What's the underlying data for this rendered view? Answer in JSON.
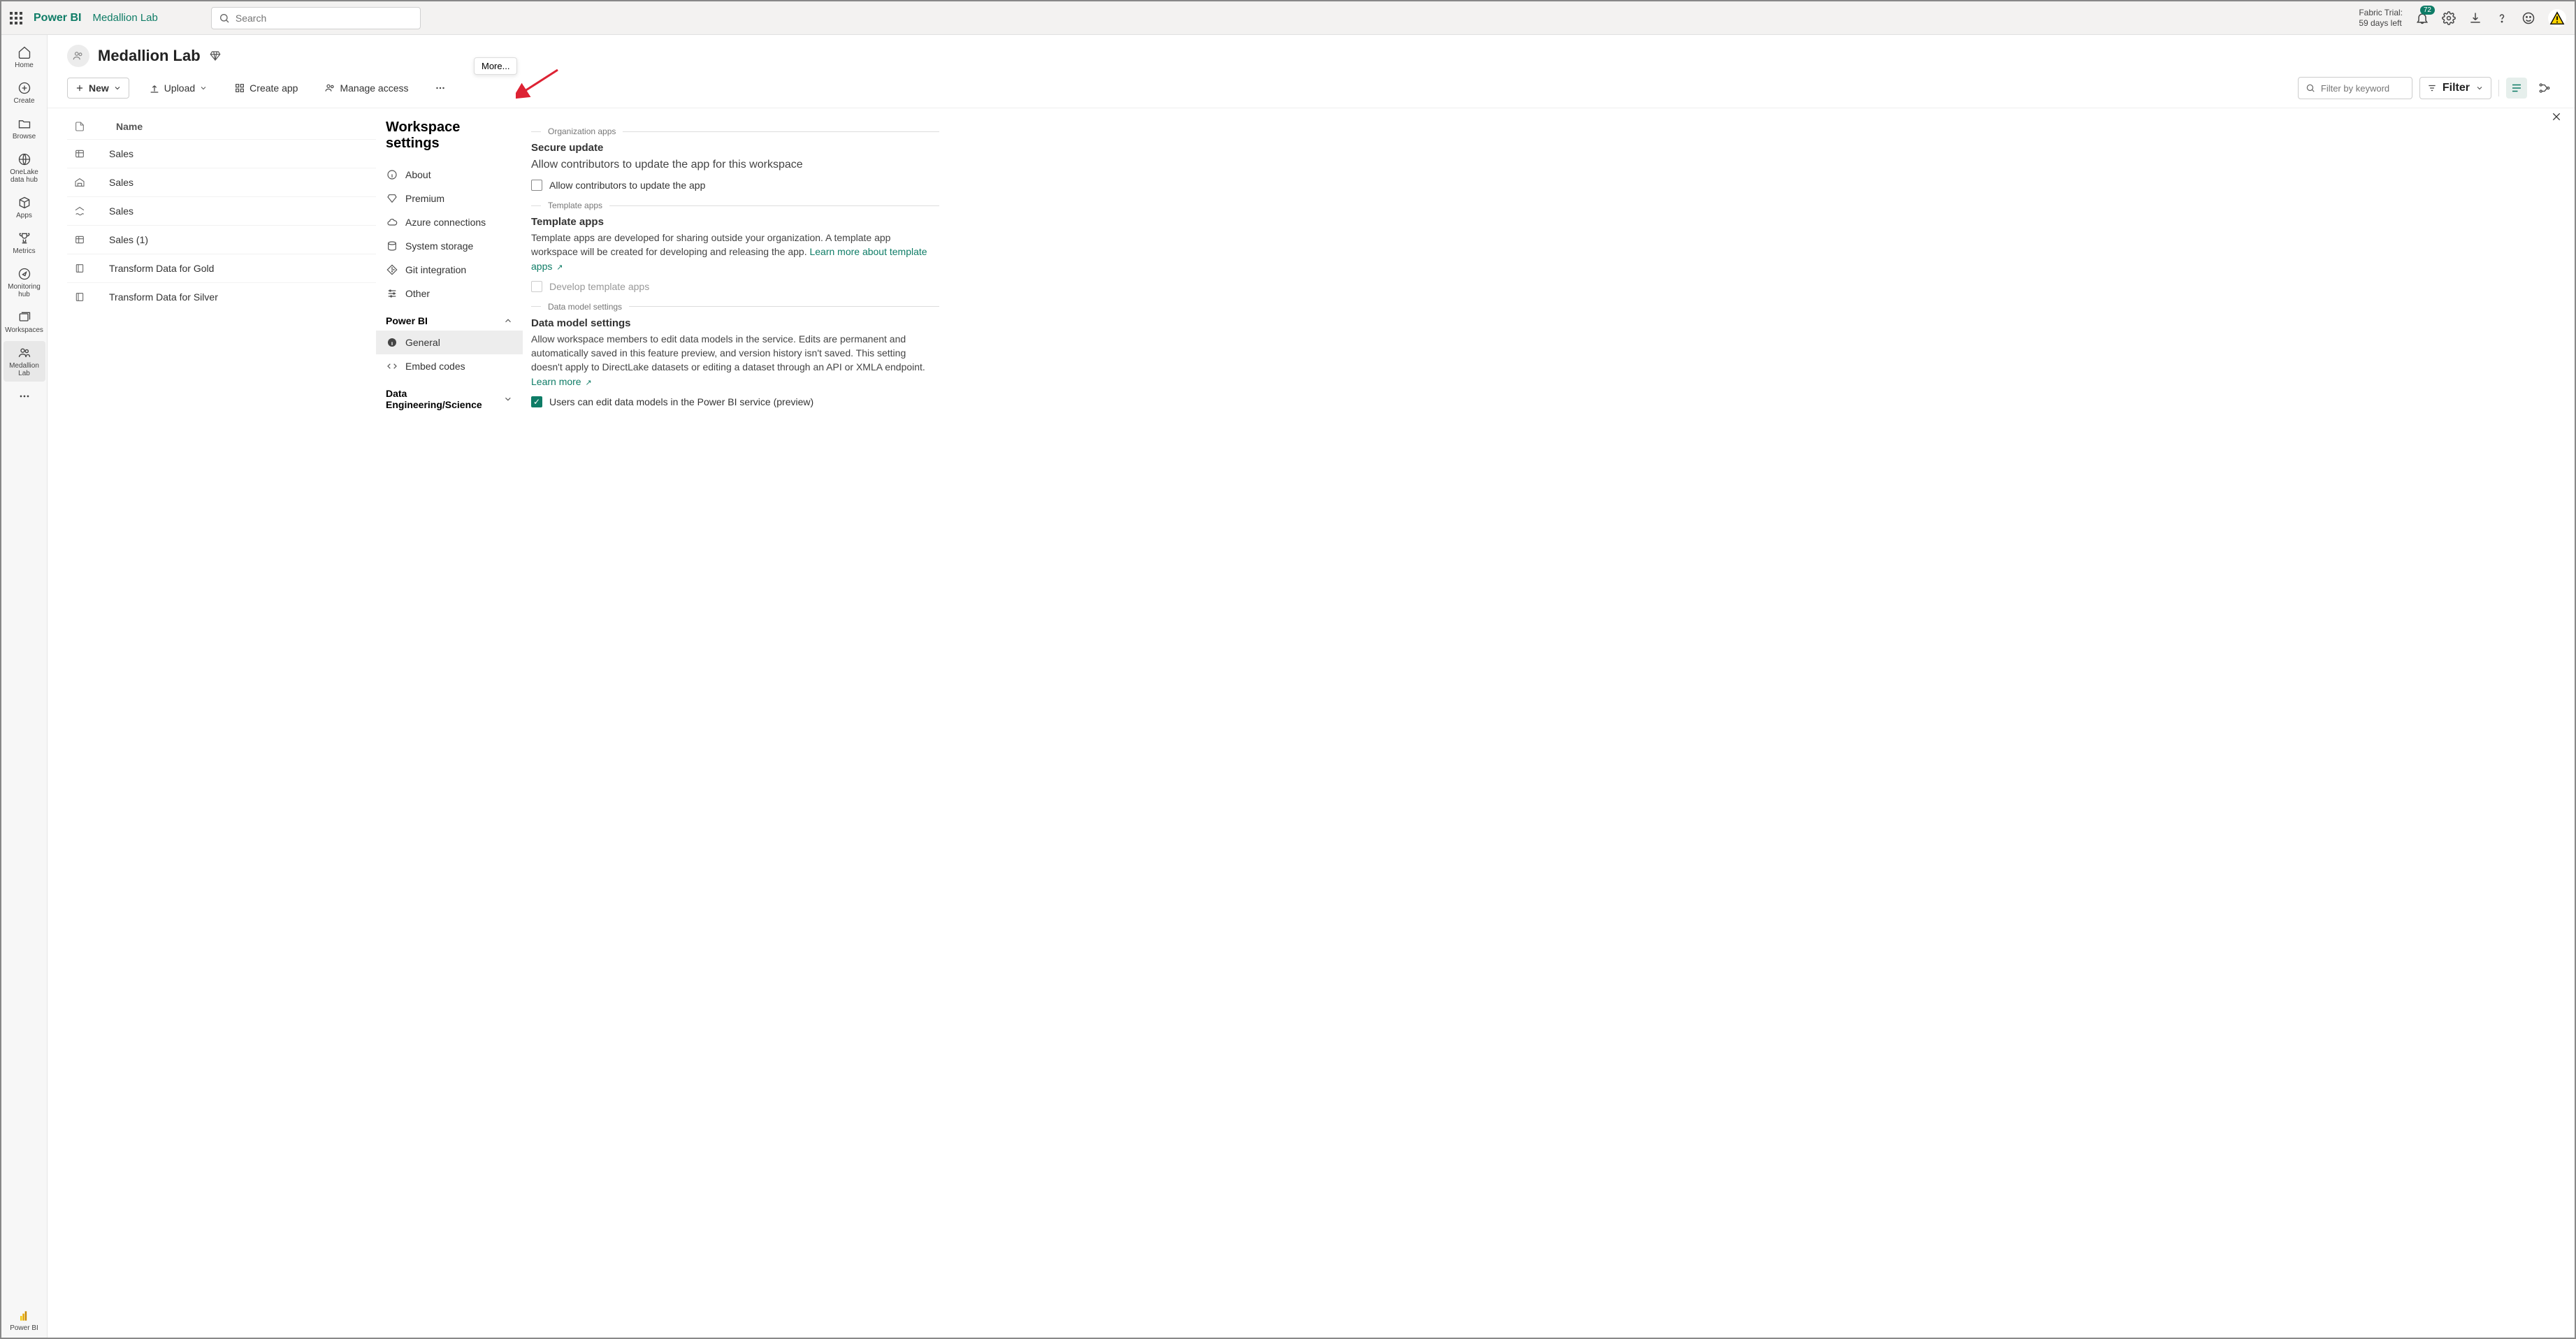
{
  "header": {
    "brand": "Power BI",
    "workspace_name": "Medallion Lab",
    "search_placeholder": "Search",
    "trial_line1": "Fabric Trial:",
    "trial_line2": "59 days left",
    "notif_count": "72"
  },
  "leftrail": {
    "home": "Home",
    "create": "Create",
    "browse": "Browse",
    "onelake": "OneLake data hub",
    "apps": "Apps",
    "metrics": "Metrics",
    "monitoring": "Monitoring hub",
    "workspaces": "Workspaces",
    "current": "Medallion Lab",
    "bottom": "Power BI"
  },
  "workspace": {
    "title": "Medallion Lab"
  },
  "toolbar": {
    "new": "New",
    "upload": "Upload",
    "create_app": "Create app",
    "manage_access": "Manage access",
    "more_tooltip": "More...",
    "filter_placeholder": "Filter by keyword",
    "filter": "Filter"
  },
  "list": {
    "name_header": "Name",
    "rows": [
      {
        "icon": "dataset",
        "name": "Sales"
      },
      {
        "icon": "warehouse",
        "name": "Sales"
      },
      {
        "icon": "lakehouse",
        "name": "Sales"
      },
      {
        "icon": "dataset",
        "name": "Sales (1)"
      },
      {
        "icon": "notebook",
        "name": "Transform Data for Gold"
      },
      {
        "icon": "notebook",
        "name": "Transform Data for Silver"
      }
    ]
  },
  "settings": {
    "title": "Workspace settings",
    "nav": {
      "about": "About",
      "premium": "Premium",
      "azure": "Azure connections",
      "storage": "System storage",
      "git": "Git integration",
      "other": "Other",
      "section_powerbi": "Power BI",
      "general": "General",
      "embed": "Embed codes",
      "section_de": "Data Engineering/Science"
    },
    "org_apps_label": "Organization apps",
    "secure_update_head": "Secure update",
    "secure_update_desc": "Allow contributors to update the app for this workspace",
    "secure_update_cb": "Allow contributors to update the app",
    "template_label": "Template apps",
    "template_head": "Template apps",
    "template_desc": "Template apps are developed for sharing outside your organization. A template app workspace will be created for developing and releasing the app. ",
    "template_link": "Learn more about template apps",
    "template_cb": "Develop template apps",
    "dm_label": "Data model settings",
    "dm_head": "Data model settings",
    "dm_desc": "Allow workspace members to edit data models in the service. Edits are permanent and automatically saved in this feature preview, and version history isn't saved. This setting doesn't apply to DirectLake datasets or editing a dataset through an API or XMLA endpoint. ",
    "dm_link": "Learn more",
    "dm_cb": "Users can edit data models in the Power BI service (preview)"
  }
}
